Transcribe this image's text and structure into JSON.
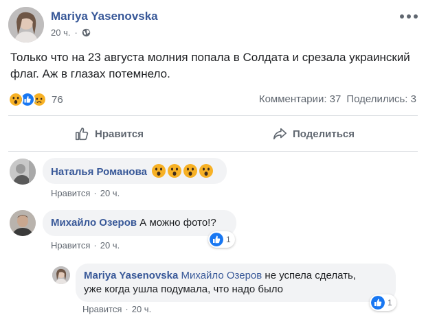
{
  "post": {
    "author": "Mariya Yasenovska",
    "time": "20 ч.",
    "text": "Только что на 23 августа молния попала в Солдата и срезала украинский флаг. Аж в глазах потемнело.",
    "reactions_count": "76",
    "comments": "Комментарии: 37",
    "shares": "Поделились: 3"
  },
  "actions": {
    "like": "Нравится",
    "share": "Поделиться"
  },
  "comments": [
    {
      "author": "Наталья Романова",
      "text": "",
      "like": "Нравится",
      "dot": "·",
      "time": "20 ч."
    },
    {
      "author": "Михайло Озеров",
      "text": "А можно фото!?",
      "like": "Нравится",
      "dot": "·",
      "time": "20 ч.",
      "reactions": "1"
    },
    {
      "author": "Mariya Yasenovska",
      "mention": "Михайло Озеров",
      "text_line1": "не успела сделать,",
      "text_line2": "уже когда ушла подумала, что надо было",
      "like": "Нравится",
      "dot": "·",
      "time": "20 ч.",
      "reactions": "1"
    }
  ],
  "colors": {
    "link": "#385898",
    "meta": "#606770",
    "bubble": "#f2f3f5",
    "like_blue": "#1877f2",
    "emoji_yellow": "#f7b125"
  }
}
